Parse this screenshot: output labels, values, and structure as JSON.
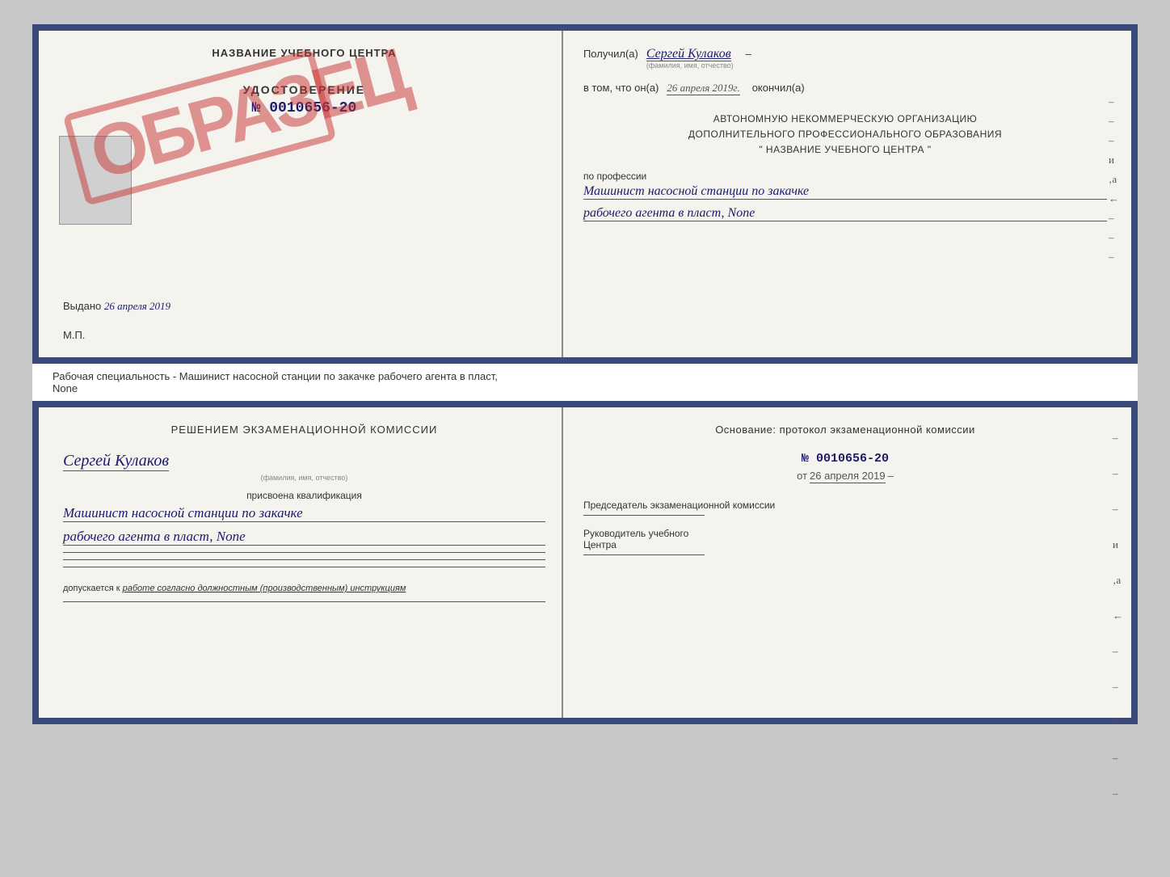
{
  "page": {
    "background": "#c8c8c8"
  },
  "top_cert": {
    "left": {
      "center_title": "НАЗВАНИЕ УЧЕБНОГО ЦЕНТРА",
      "udostoverenie_title": "УДОСТОВЕРЕНИЕ",
      "udost_number": "№ 0010656-20",
      "vydano_label": "Выдано",
      "vydano_date": "26 апреля 2019",
      "mp_label": "М.П."
    },
    "stamp": {
      "text": "ОБРАЗЕЦ"
    },
    "right": {
      "poluchil_label": "Получил(а)",
      "poluchil_name": "Сергей Кулаков",
      "fio_hint": "(фамилия, имя, отчество)",
      "dash": "–",
      "vtom_label": "в том, что он(а)",
      "vtom_date": "26 апреля 2019г.",
      "okonchil_label": "окончил(а)",
      "org_line1": "АВТОНОМНУЮ НЕКОММЕРЧЕСКУЮ ОРГАНИЗАЦИЮ",
      "org_line2": "ДОПОЛНИТЕЛЬНОГО ПРОФЕССИОНАЛЬНОГО ОБРАЗОВАНИЯ",
      "org_line3": "\" НАЗВАНИЕ УЧЕБНОГО ЦЕНТРА \"",
      "po_professii": "по профессии",
      "profession_line1": "Машинист насосной станции по закачке",
      "profession_line2": "рабочего агента в пласт, None"
    }
  },
  "subtitle": {
    "text": "Рабочая специальность - Машинист насосной станции по закачке рабочего агента в пласт,",
    "text2": "None"
  },
  "bottom_cert": {
    "left": {
      "resheniem_title": "Решением экзаменационной комиссии",
      "name": "Сергей Кулаков",
      "fio_hint": "(фамилия, имя, отчество)",
      "prisvoena": "присвоена квалификация",
      "qual_line1": "Машинист насосной станции по закачке",
      "qual_line2": "рабочего агента в пласт, None",
      "dopuskaetsya_text": "допускается к",
      "dopusk_italic": "работе согласно должностным (производственным) инструкциям"
    },
    "right": {
      "osnovanie_title": "Основание: протокол экзаменационной комиссии",
      "protocol_number": "№ 0010656-20",
      "ot_label": "от",
      "ot_date": "26 апреля 2019",
      "predsedatel_label": "Председатель экзаменационной комиссии",
      "rukovoditel_label": "Руководитель учебного",
      "tsentra_label": "Центра"
    }
  }
}
